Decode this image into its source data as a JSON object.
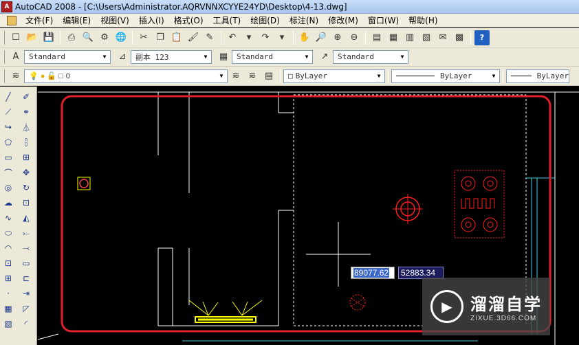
{
  "window": {
    "title": "AutoCAD 2008 - [C:\\Users\\Administrator.AQRVNNXCYYE24YD\\Desktop\\4-13.dwg]",
    "app_icon_text": "A"
  },
  "menu": {
    "items": [
      "文件(F)",
      "编辑(E)",
      "视图(V)",
      "插入(I)",
      "格式(O)",
      "工具(T)",
      "绘图(D)",
      "标注(N)",
      "修改(M)",
      "窗口(W)",
      "帮助(H)"
    ]
  },
  "styles_toolbar": {
    "text_style": "Standard",
    "dim_style": "副本 123",
    "table_style": "Standard",
    "multileader_style": "Standard"
  },
  "layers_toolbar": {
    "layer_name": "0",
    "color": "ByLayer",
    "linetype": "ByLayer",
    "lineweight": "ByLayer"
  },
  "dynamic_input": {
    "x_value": "89077.62",
    "y_value": "52883.34"
  },
  "watermark": {
    "name": "溜溜自学",
    "url": "ZIXUE.3D66.COM"
  },
  "colors": {
    "highlight_outline": "#e0202a",
    "hatch_red": "#ff2020",
    "symbol_yellow": "#ffff00",
    "door_cyan": "#40d0e0",
    "line_white": "#ffffff"
  }
}
